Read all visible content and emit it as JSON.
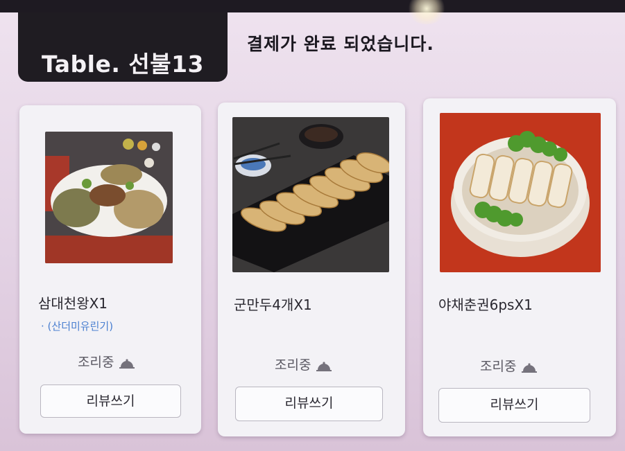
{
  "header": {
    "table_label": "Table. 선불13",
    "status_message": "결제가 완료 되었습니다."
  },
  "orders": [
    {
      "name": "삼대천왕",
      "quantity": "X1",
      "option": "· (산더미유린기)",
      "status": "조리중",
      "review_label": "리뷰쓰기"
    },
    {
      "name": "군만두4개",
      "quantity": "X1",
      "status": "조리중",
      "review_label": "리뷰쓰기"
    },
    {
      "name": "야채춘권6ps",
      "quantity": "X1",
      "status": "조리중",
      "review_label": "리뷰쓰기"
    }
  ],
  "icons": {
    "status_icon": "serving-bell-icon"
  },
  "colors": {
    "header_bg": "#1f1c22",
    "option_text": "#4a7fd0",
    "card_bg": "#f3f2f6"
  }
}
